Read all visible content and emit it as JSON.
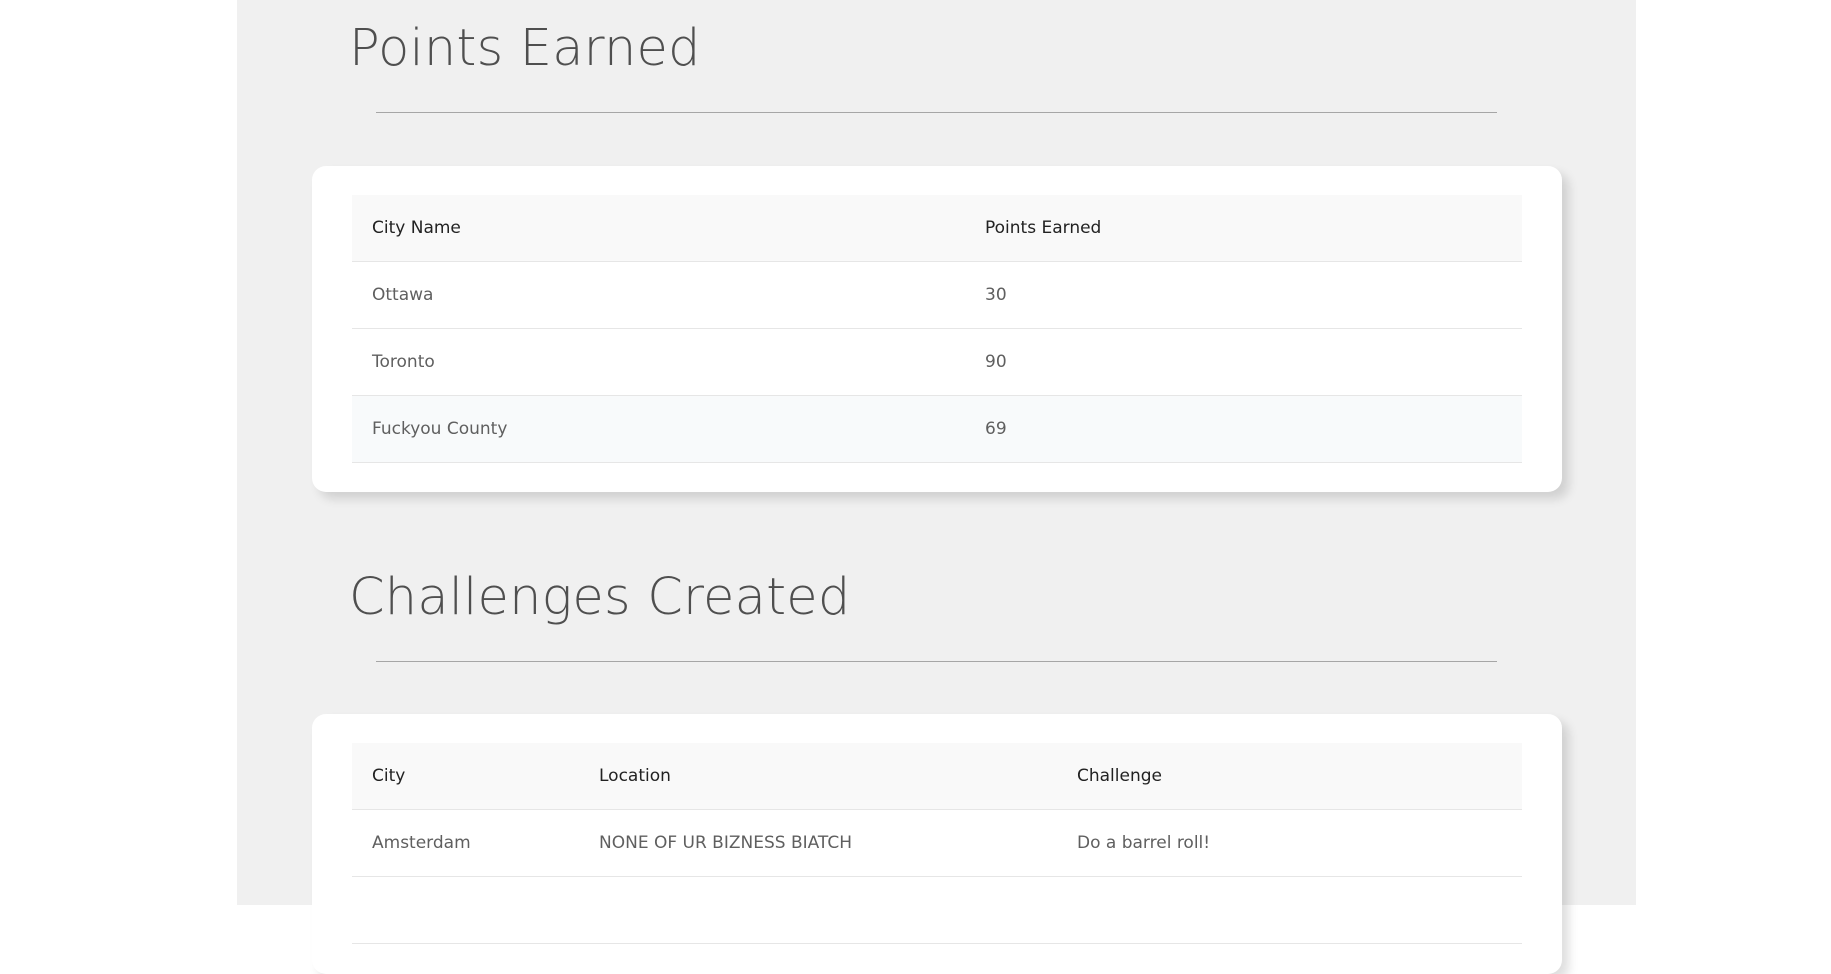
{
  "points_section": {
    "title": "Points Earned",
    "table": {
      "headers": [
        "City Name",
        "Points Earned"
      ],
      "rows": [
        [
          "Ottawa",
          "30"
        ],
        [
          "Toronto",
          "90"
        ],
        [
          "Fuckyou County",
          "69"
        ]
      ]
    }
  },
  "challenges_section": {
    "title": "Challenges Created",
    "table": {
      "headers": [
        "City",
        "Location",
        "Challenge"
      ],
      "rows": [
        [
          "Amsterdam",
          "NONE OF UR BIZNESS BIATCH",
          "Do a barrel roll!"
        ]
      ]
    }
  },
  "colors": {
    "page_background": "#ffffff",
    "column_background": "#f0f0f0",
    "card_background": "#ffffff",
    "header_row_background": "#f9f9f9",
    "hover_row_background": "#f8fafb"
  }
}
